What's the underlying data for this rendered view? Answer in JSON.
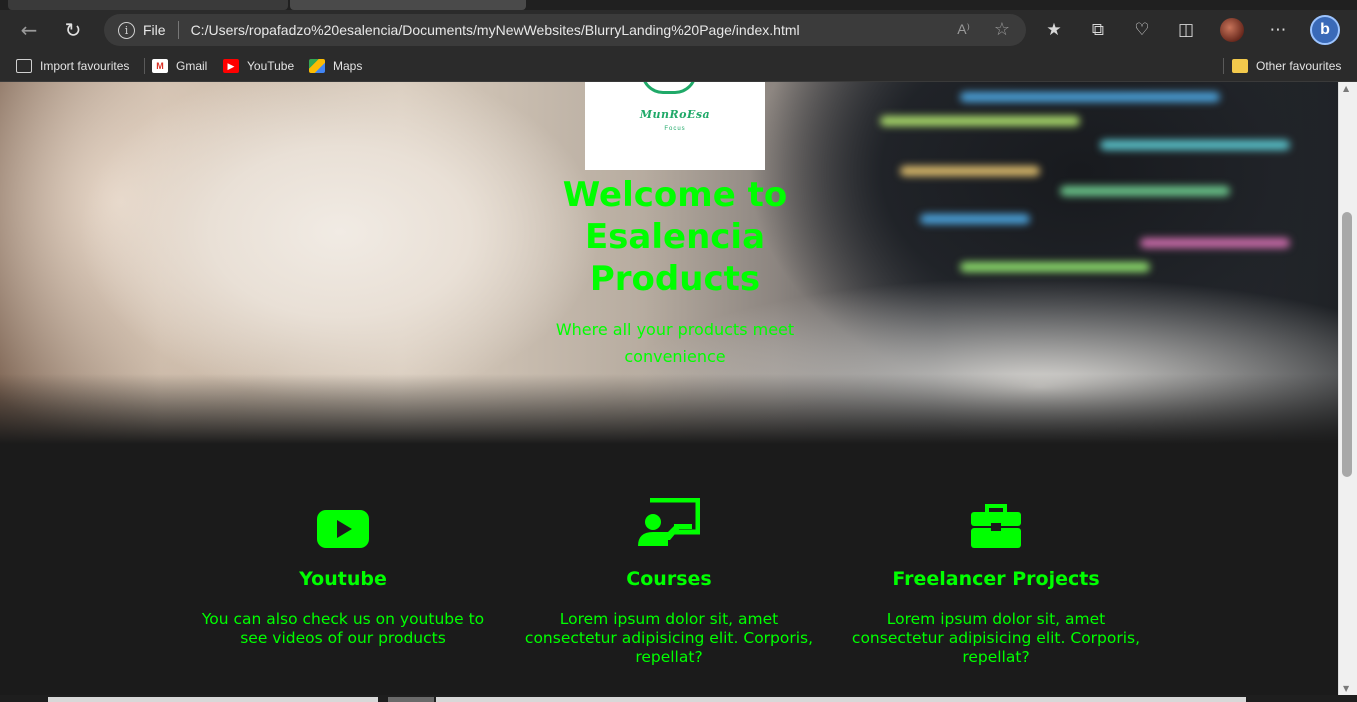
{
  "browser": {
    "address": {
      "scheme_label": "File",
      "url": "C:/Users/ropafadzo%20esalencia/Documents/myNewWebsites/BlurryLanding%20Page/index.html",
      "read_aloud_label": "A⁾"
    },
    "favourites": [
      {
        "label": "Import favourites",
        "icon": "import-icon"
      },
      {
        "label": "Gmail",
        "icon": "gmail-icon"
      },
      {
        "label": "YouTube",
        "icon": "youtube-icon"
      },
      {
        "label": "Maps",
        "icon": "maps-icon"
      }
    ],
    "other_favourites": "Other favourites",
    "profile_initial": "b"
  },
  "page": {
    "logo": {
      "brand": "MunRoEsa",
      "tagline": "Focus"
    },
    "hero_title": "Welcome to Esalencia Products",
    "hero_subtitle": "Where all your products meet convenience",
    "features": [
      {
        "icon": "youtube-icon",
        "title": "Youtube",
        "text": "You can also check us on youtube to see videos of our products"
      },
      {
        "icon": "presentation-icon",
        "title": "Courses",
        "text": "Lorem ipsum dolor sit, amet consectetur adipisicing elit. Corporis, repellat?"
      },
      {
        "icon": "briefcase-icon",
        "title": "Freelancer Projects",
        "text": "Lorem ipsum dolor sit, amet consectetur adipisicing elit. Corporis, repellat?"
      }
    ],
    "accent_color": "#00ff00"
  }
}
